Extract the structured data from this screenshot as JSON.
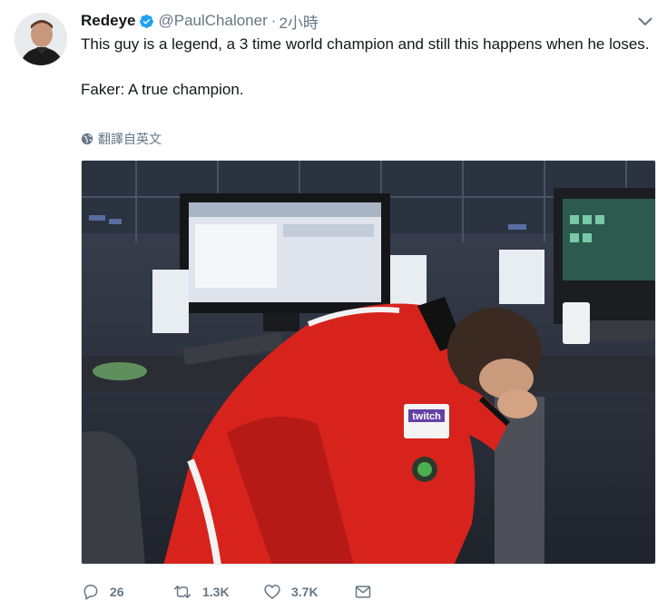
{
  "tweet": {
    "author_name": "Redeye",
    "author_handle": "@PaulChaloner",
    "separator": "·",
    "timestamp": "2小時",
    "text_line1": "This guy is a legend, a 3 time world champion and still this happens when he loses.",
    "text_line2": "Faker: A true champion.",
    "translate_label": "翻譯自英文"
  },
  "media": {
    "jersey_text": "twitch"
  },
  "actions": {
    "reply_count": "26",
    "retweet_count": "1.3K",
    "like_count": "3.7K"
  },
  "colors": {
    "accent": "#1da1f2",
    "secondary_text": "#657786",
    "primary_text": "#14171a",
    "jersey_red": "#d8231d"
  },
  "icons": [
    "verified-badge-icon",
    "chevron-down-icon",
    "globe-icon",
    "reply-icon",
    "retweet-icon",
    "like-icon",
    "direct-message-icon"
  ]
}
